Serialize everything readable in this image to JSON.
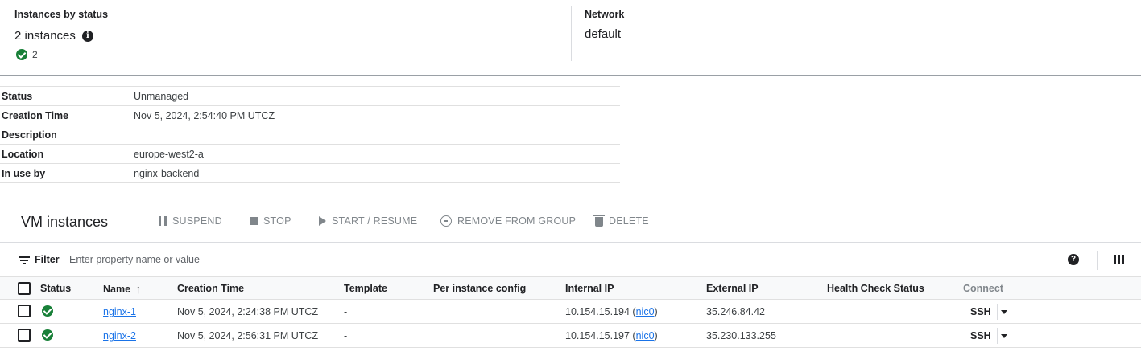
{
  "summary": {
    "instances_by_status_label": "Instances by status",
    "instances_count_text": "2 instances",
    "info_icon": "info-icon",
    "running_count": "2",
    "network_label": "Network",
    "network_value": "default"
  },
  "details": [
    {
      "key": "Status",
      "value": "Unmanaged"
    },
    {
      "key": "Creation Time",
      "value": "Nov 5, 2024, 2:54:40 PM UTCZ"
    },
    {
      "key": "Description",
      "value": ""
    },
    {
      "key": "Location",
      "value": "europe-west2-a"
    },
    {
      "key": "In use by",
      "value": "nginx-backend"
    }
  ],
  "vm_section": {
    "title": "VM instances",
    "actions": {
      "suspend": "SUSPEND",
      "stop": "STOP",
      "start_resume": "START / RESUME",
      "remove_from_group": "REMOVE FROM GROUP",
      "delete": "DELETE"
    }
  },
  "filter": {
    "label": "Filter",
    "placeholder": "Enter property name or value"
  },
  "table": {
    "columns": {
      "status": "Status",
      "name": "Name",
      "sort_arrow": "↑",
      "creation_time": "Creation Time",
      "template": "Template",
      "per_instance_config": "Per instance config",
      "internal_ip": "Internal IP",
      "external_ip": "External IP",
      "health_check_status": "Health Check Status",
      "connect": "Connect"
    },
    "rows": [
      {
        "status_icon": "check-circle-icon",
        "name": "nginx-1",
        "creation_time": "Nov 5, 2024, 2:24:38 PM UTCZ",
        "template": "-",
        "internal_ip": "10.154.15.194",
        "nic": "nic0",
        "external_ip": "35.246.84.42",
        "connect": "SSH"
      },
      {
        "status_icon": "check-circle-icon",
        "name": "nginx-2",
        "creation_time": "Nov 5, 2024, 2:56:31 PM UTCZ",
        "template": "-",
        "internal_ip": "10.154.15.197",
        "nic": "nic0",
        "external_ip": "35.230.133.255",
        "connect": "SSH"
      }
    ]
  },
  "colors": {
    "link": "#1a73e8",
    "success": "#188038",
    "disabled_action": "#80868b"
  }
}
